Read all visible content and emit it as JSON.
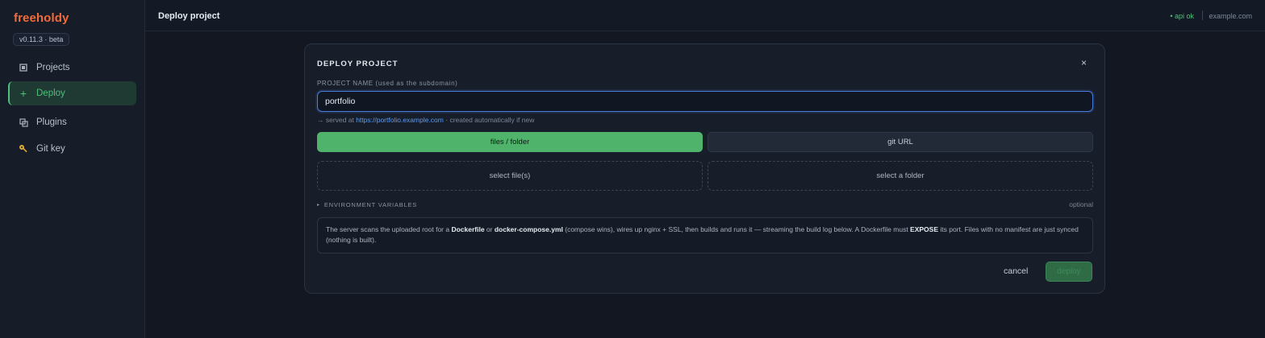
{
  "sidebar": {
    "brand": "freeholdy",
    "version": "v0.11.3 · beta",
    "items": [
      {
        "label": "Projects",
        "icon": "square-icon"
      },
      {
        "label": "Deploy",
        "icon": "plus-icon",
        "active": true
      },
      {
        "label": "Plugins",
        "icon": "plugin-icon"
      },
      {
        "label": "Git key",
        "icon": "key-icon"
      }
    ]
  },
  "topbar": {
    "title": "Deploy project",
    "api_status": "• api ok",
    "host": "example.com"
  },
  "modal": {
    "title": "DEPLOY PROJECT",
    "close_label": "×",
    "name_label": "PROJECT NAME (used as the subdomain)",
    "name_value": "portfolio",
    "served_prefix": "→ served at",
    "served_url": "https://portfolio.example.com",
    "served_suffix": "· created automatically if new",
    "tab_files": "files / folder",
    "tab_git": "git URL",
    "select_files": "select file(s)",
    "select_folder": "select a folder",
    "env_label": "ENVIRONMENT VARIABLES",
    "env_optional": "optional",
    "info": {
      "p1": "The server scans the uploaded root for a ",
      "b1": "Dockerfile",
      "p2": " or ",
      "b2": "docker-compose.yml",
      "p3": " (compose wins), wires up nginx + SSL, then builds and runs it — streaming the build log below. A Dockerfile must ",
      "b3": "EXPOSE",
      "p4": " its port. Files with no manifest are just synced (nothing is built)."
    },
    "cancel": "cancel",
    "deploy": "deploy"
  },
  "colors": {
    "brand": "#f26b3a",
    "accent_green": "#4fb36c",
    "link_blue": "#5b9cf0",
    "background": "#121722"
  }
}
